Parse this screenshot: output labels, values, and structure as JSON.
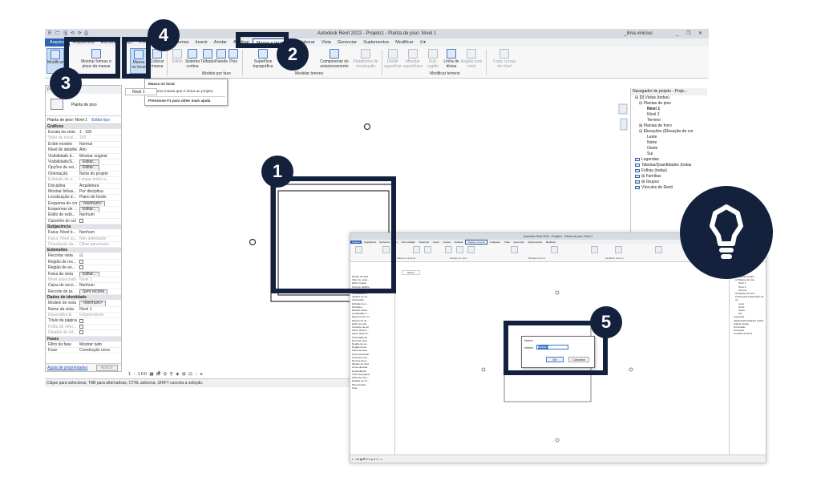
{
  "window": {
    "title": "Autodesk Revit 2022 - Projeto1 - Planta de piso: Nível 1",
    "quick_access": "R 🗁 🖫 ⟲ ⟳ ⎙",
    "user": "_lima.vinicius",
    "controls": "_ ❐ ✕"
  },
  "menu_tabs": [
    "Arquivo",
    "Arquitetura",
    "Estrutura",
    "Aço",
    "Pré-moldado",
    "Sistemas",
    "Inserir",
    "Anotar",
    "Analisar",
    "Massa e terreno",
    "Colaborar",
    "Vista",
    "Gerenciar",
    "Suplementos",
    "Modificar",
    "⊙▾"
  ],
  "ribbon": {
    "modify": "Modificar",
    "show_mass": "Mostrar formas e pisos da massa",
    "in_place_mass": "Massa no local",
    "place_mass": "Colocar massa",
    "wall_by_face_dim": "Sólido",
    "curtain_system": "Sistema cortina",
    "roof": "Telhado",
    "wall": "Parede",
    "floor": "Piso",
    "toposurface": "Superfície topográfica",
    "site_component": "Componente do estacionamento",
    "building_pad": "Plataforma de construção",
    "split_surface": "Dividir superfície",
    "merge_surfaces": "Mesclar superfícies",
    "subregion": "Sub-região",
    "property_line": "Linha de divisa",
    "graded_region": "Região com nível",
    "label_contours": "Cotar curvas de nível",
    "parking_comp": "Componente do estacionamento",
    "group_conceptual": "Massa conceitual",
    "group_by_face": "Modelo por face",
    "group_site": "Modelar terreno",
    "group_modify_site": "Modificar terreno"
  },
  "tooltip": {
    "title": "Massa no local",
    "desc": "Cria uma massa que é única ao projeto.",
    "help": "Pressione F1 para obter mais ajuda"
  },
  "properties": {
    "header": "Propriedades",
    "type_label": "Planta de piso",
    "filter": "Planta de piso: Nível 1",
    "edit_type": "Editar tipo",
    "sections": [
      {
        "title": "Gráficos",
        "rows": [
          [
            "Escala da vista",
            "1 : 100",
            false
          ],
          [
            "Valor de escal...",
            "100",
            true
          ],
          [
            "Exibir modelo",
            "Normal",
            false
          ],
          [
            "Nível de detalhe",
            "Alto",
            false
          ],
          [
            "Visibilidade d...",
            "Mostrar original",
            false
          ],
          [
            "Visibilidade/S...",
            "Editar...",
            false
          ],
          [
            "Opções de exi...",
            "Editar...",
            false
          ],
          [
            "Orientação",
            "Norte do projeto",
            false
          ],
          [
            "Exibição de u...",
            "Limpar todos a...",
            true
          ],
          [
            "Disciplina",
            "Arquitetura",
            false
          ],
          [
            "Mostrar linhas...",
            "Por disciplina",
            false
          ],
          [
            "Localização d...",
            "Plano de fundo",
            false
          ],
          [
            "Esquema de cor",
            "<nenhum>",
            false
          ],
          [
            "Esquemas de ...",
            "Editar...",
            false
          ],
          [
            "Estilo de exib...",
            "Nenhum",
            false
          ],
          [
            "Caminho do sol",
            "",
            false
          ]
        ]
      },
      {
        "title": "Subjacência",
        "rows": [
          [
            "Faixa: Nível b...",
            "Nenhum",
            false
          ],
          [
            "Faixa: Nível su...",
            "Não delimitado",
            true
          ],
          [
            "Orientação da...",
            "Olhar para baixo",
            true
          ]
        ]
      },
      {
        "title": "Extensões",
        "rows": [
          [
            "Recortar vista",
            "☑",
            false
          ],
          [
            "Região de rec...",
            "",
            false
          ],
          [
            "Região de an...",
            "",
            false
          ],
          [
            "Faixa da vista",
            "Editar...",
            false
          ],
          [
            "Nível associado",
            "Nível 1",
            true
          ],
          [
            "Caixa de esco...",
            "Nenhum",
            false
          ],
          [
            "Recorte de pr...",
            "Sem recorte",
            false
          ]
        ]
      },
      {
        "title": "Dados de identidade",
        "rows": [
          [
            "Modelo de vista",
            "<Nenhum>",
            false
          ],
          [
            "Nome da vista",
            "Nível 1",
            false
          ],
          [
            "Dependência",
            "Independente",
            true
          ],
          [
            "Título da página",
            "",
            false
          ],
          [
            "Folha de refer...",
            "",
            true
          ],
          [
            "Detalhe de ref...",
            "",
            true
          ]
        ]
      },
      {
        "title": "Fases",
        "rows": [
          [
            "Filtro da fase",
            "Mostrar tudo",
            false
          ],
          [
            "Fase",
            "Construção nova",
            false
          ]
        ]
      }
    ],
    "help_link": "Ajuda de propriedades",
    "apply": "Aplicar"
  },
  "view": {
    "tab": "Nível 1",
    "scale_bar": "1 : 100  ▦ 🗗 ⛭ ⚲ ◈ ⊞ ⊡ ◌ ▸"
  },
  "status_bar": "Clique para selecionar, TAB para alternativas, CTRL adiciona, SHIFT cancela a seleção.",
  "browser": {
    "header": "Navegador de projeto - Proje...",
    "items": [
      {
        "text": "⊟ [0] Vistas (todas)",
        "indent": 1
      },
      {
        "text": "⊟ Plantas de piso",
        "indent": 2
      },
      {
        "text": "Nível 1",
        "indent": 4,
        "bold": true
      },
      {
        "text": "Nível 2",
        "indent": 4
      },
      {
        "text": "Terreno",
        "indent": 4
      },
      {
        "text": "⊞ Plantas de forro",
        "indent": 2
      },
      {
        "text": "⊟ Elevações (Elevação de cor",
        "indent": 2
      },
      {
        "text": "Leste",
        "indent": 4
      },
      {
        "text": "Norte",
        "indent": 4
      },
      {
        "text": "Oeste",
        "indent": 4
      },
      {
        "text": "Sul",
        "indent": 4
      },
      {
        "text": "Legendas",
        "indent": 1,
        "icon": true
      },
      {
        "text": "Tabelas/Quantidades (todas",
        "indent": 1,
        "icon": true
      },
      {
        "text": "Folhas (todas)",
        "indent": 1,
        "icon": true
      },
      {
        "text": "⊞ Famílias",
        "indent": 1,
        "icon": true
      },
      {
        "text": "⊞ Grupos",
        "indent": 1,
        "icon": true
      },
      {
        "text": "Vínculos do Revit",
        "indent": 1,
        "icon": true
      }
    ]
  },
  "dialog": {
    "title": "Nome",
    "label": "Nome:",
    "value": "Massa 1",
    "ok": "OK",
    "cancel": "Cancelar"
  },
  "badges": [
    "1",
    "2",
    "3",
    "4",
    "5"
  ],
  "colors": {
    "accent": "#14213d",
    "file_tab": "#2c64b1",
    "selection": "#3a73c4"
  }
}
